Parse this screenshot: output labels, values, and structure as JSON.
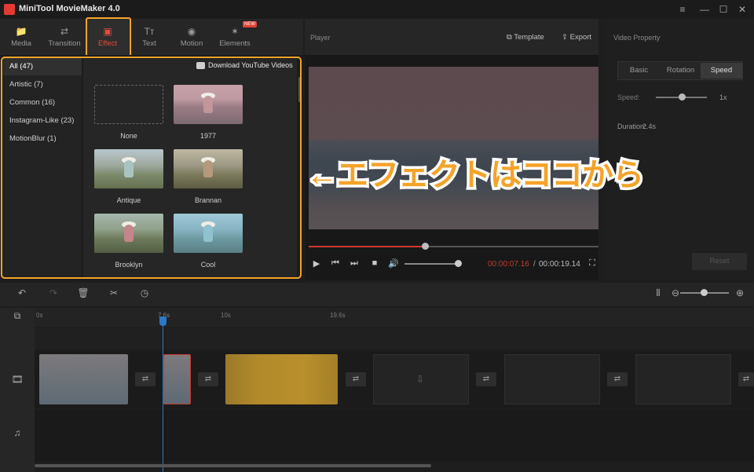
{
  "app": {
    "title": "MiniTool MovieMaker 4.0"
  },
  "window_controls": {
    "menu": "≡",
    "minimize": "—",
    "maximize": "☐",
    "close": "✕"
  },
  "toolbar": {
    "items": [
      {
        "label": "Media",
        "icon": "📁"
      },
      {
        "label": "Transition",
        "icon": "⇄"
      },
      {
        "label": "Effect",
        "icon": "▣"
      },
      {
        "label": "Text",
        "icon": "Tт"
      },
      {
        "label": "Motion",
        "icon": "◉"
      },
      {
        "label": "Elements",
        "icon": "✶"
      }
    ],
    "new_badge": "NEW",
    "active": "Effect",
    "accent": "#e84b3c"
  },
  "effect_panel": {
    "categories": [
      "All (47)",
      "Artistic (7)",
      "Common (16)",
      "Instagram-Like (23)",
      "MotionBlur (1)"
    ],
    "download_label": "Download YouTube Videos",
    "effects": [
      "None",
      "1977",
      "Antique",
      "Brannan",
      "Brooklyn",
      "Cool"
    ]
  },
  "player": {
    "title": "Player",
    "template_label": "Template",
    "export_label": "Export",
    "progress": 0.4,
    "time_current": "00:00:07.16",
    "time_separator": "/",
    "time_total": "00:00:19.14"
  },
  "video_property": {
    "title": "Video Property",
    "tabs": [
      "Basic",
      "Rotation",
      "Speed"
    ],
    "active_tab": "Speed",
    "speed_label": "Speed:",
    "speed_value": "1x",
    "duration_label": "Duration:",
    "duration_value": "2.4s",
    "reset_label": "Reset"
  },
  "annotation": {
    "text": "←エフェクトはココから",
    "color": "#f4a32a"
  },
  "timeline": {
    "ruler_ticks": [
      "0s",
      "7.6s",
      "10s",
      "19.6s"
    ]
  }
}
